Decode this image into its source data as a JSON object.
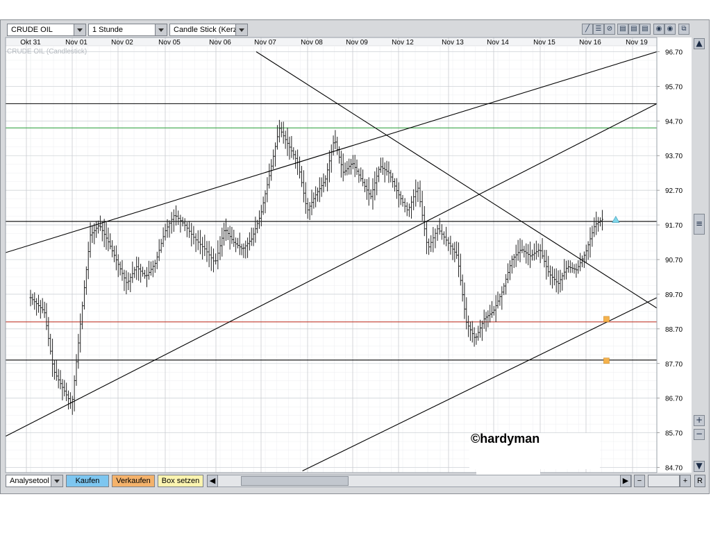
{
  "toolbar": {
    "instrument": "CRUDE OIL",
    "interval": "1 Stunde",
    "chart_type": "Candle Stick (Kerze"
  },
  "tool_icons": [
    "line-tool-icon",
    "fibonacci-icon",
    "no-draw-icon",
    "grid-icon-1",
    "grid-icon-2",
    "grid-icon-3",
    "settings-icon-1",
    "settings-icon-2",
    "detach-window-icon"
  ],
  "bottom_bar": {
    "analysis_tool": "Analysetool",
    "buy": "Kaufen",
    "sell": "Verkaufen",
    "box_set": "Box setzen",
    "reset": "R"
  },
  "watermark": "©hardyman",
  "colors": {
    "resistance_line": "#000000",
    "green_line": "#3aa64a",
    "red_line": "#c0392b",
    "marker_orange": "#f5b24c",
    "marker_cyan": "#7fd6ea"
  },
  "chart_data": {
    "type": "candlestick",
    "title": "CRUDE OIL (Candlestick)",
    "interval": "1 Stunde",
    "x_ticks": [
      "Okt 31",
      "Nov 01",
      "Nov 02",
      "Nov 05",
      "Nov 06",
      "Nov 07",
      "Nov 08",
      "Nov 09",
      "Nov 12",
      "Nov 13",
      "Nov 14",
      "Nov 15",
      "Nov 16",
      "Nov 19"
    ],
    "y_ticks": [
      "96.70",
      "95.70",
      "94.70",
      "93.70",
      "92.70",
      "91.70",
      "90.70",
      "89.70",
      "88.70",
      "87.70",
      "86.70",
      "85.70",
      "84.70"
    ],
    "ylim": [
      84.55,
      96.85
    ],
    "price_series": [
      [
        0,
        89.6
      ],
      [
        0.3,
        89.2
      ],
      [
        0.5,
        87.5
      ],
      [
        0.7,
        87.0
      ],
      [
        0.9,
        86.5
      ],
      [
        1.1,
        89.0
      ],
      [
        1.3,
        91.4
      ],
      [
        1.5,
        91.7
      ],
      [
        1.7,
        91.2
      ],
      [
        1.9,
        90.6
      ],
      [
        2.1,
        90.0
      ],
      [
        2.3,
        90.5
      ],
      [
        2.5,
        90.2
      ],
      [
        2.7,
        90.6
      ],
      [
        2.9,
        91.5
      ],
      [
        3.1,
        92.0
      ],
      [
        3.3,
        91.7
      ],
      [
        3.5,
        91.3
      ],
      [
        3.7,
        91.0
      ],
      [
        3.9,
        90.6
      ],
      [
        4.1,
        91.6
      ],
      [
        4.3,
        91.2
      ],
      [
        4.5,
        91.0
      ],
      [
        4.7,
        91.3
      ],
      [
        4.9,
        92.0
      ],
      [
        5.1,
        93.2
      ],
      [
        5.3,
        94.5
      ],
      [
        5.5,
        94.0
      ],
      [
        5.7,
        93.5
      ],
      [
        5.9,
        92.1
      ],
      [
        6.1,
        92.6
      ],
      [
        6.3,
        93.0
      ],
      [
        6.5,
        94.2
      ],
      [
        6.7,
        93.2
      ],
      [
        6.9,
        93.5
      ],
      [
        7.1,
        93.0
      ],
      [
        7.3,
        92.5
      ],
      [
        7.5,
        93.4
      ],
      [
        7.7,
        93.2
      ],
      [
        7.9,
        92.6
      ],
      [
        8.1,
        92.1
      ],
      [
        8.3,
        92.8
      ],
      [
        8.5,
        91.0
      ],
      [
        8.7,
        91.6
      ],
      [
        8.9,
        91.2
      ],
      [
        9.1,
        90.8
      ],
      [
        9.3,
        88.9
      ],
      [
        9.5,
        88.4
      ],
      [
        9.7,
        89.0
      ],
      [
        9.9,
        89.2
      ],
      [
        10.1,
        89.8
      ],
      [
        10.3,
        90.7
      ],
      [
        10.5,
        91.0
      ],
      [
        10.7,
        90.8
      ],
      [
        10.9,
        91.0
      ],
      [
        11.1,
        90.3
      ],
      [
        11.3,
        90.0
      ],
      [
        11.5,
        90.5
      ],
      [
        11.7,
        90.4
      ],
      [
        11.9,
        90.9
      ],
      [
        12.1,
        91.7
      ],
      [
        12.3,
        91.9
      ]
    ],
    "horizontal_levels": [
      {
        "value": 95.2,
        "color": "black"
      },
      {
        "value": 94.5,
        "color": "green"
      },
      {
        "value": 91.8,
        "color": "black"
      },
      {
        "value": 88.9,
        "color": "red"
      },
      {
        "value": 87.8,
        "color": "black"
      }
    ],
    "trend_lines": [
      {
        "from": [
          0,
          90.9
        ],
        "to": [
          8.4,
          96.7
        ]
      },
      {
        "from": [
          0,
          85.6
        ],
        "to": [
          14,
          95.2
        ]
      },
      {
        "from": [
          5.8,
          84.6
        ],
        "to": [
          14,
          89.6
        ]
      },
      {
        "from": [
          4.8,
          96.7
        ],
        "to": [
          14,
          89.3
        ]
      }
    ],
    "markers": [
      {
        "shape": "square",
        "x": 12.35,
        "y": 88.98,
        "color": "orange"
      },
      {
        "shape": "square",
        "x": 12.35,
        "y": 87.78,
        "color": "orange"
      },
      {
        "shape": "triangle",
        "x": 12.55,
        "y": 91.85,
        "color": "cyan"
      }
    ]
  }
}
